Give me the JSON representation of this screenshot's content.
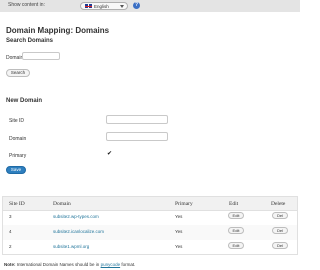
{
  "topbar": {
    "show_content_label": "Show content in:",
    "language_selected": "English",
    "flag_icon": "uk-flag-icon",
    "help_icon": "help-icon",
    "help_symbol": "?"
  },
  "page": {
    "title": "Domain Mapping: Domains"
  },
  "search": {
    "heading": "Search Domains",
    "domain_label": "Domain :",
    "domain_value": "",
    "button_label": "Search"
  },
  "new_domain": {
    "heading": "New Domain",
    "site_id_label": "Site ID",
    "domain_label": "Domain",
    "primary_label": "Primary",
    "primary_checked": true,
    "checkmark": "✔",
    "save_label": "Save"
  },
  "table": {
    "columns": [
      "Site ID",
      "Domain",
      "Primary",
      "Edit",
      "Delete"
    ],
    "rows": [
      {
        "site_id": "3",
        "domain": "subsite2.wp-types.com",
        "primary": "Yes",
        "edit": "Edit",
        "delete": "Del"
      },
      {
        "site_id": "4",
        "domain": "subsite2.icanlocalize.com",
        "primary": "Yes",
        "edit": "Edit",
        "delete": "Del"
      },
      {
        "site_id": "2",
        "domain": "subsite1.wpml.org",
        "primary": "Yes",
        "edit": "Edit",
        "delete": "Del"
      }
    ]
  },
  "footer": {
    "note_label": "Note:",
    "note_text": "International Domain Names should be in",
    "note_link": "punycode",
    "note_suffix": "format."
  },
  "colors": {
    "link": "#21759b",
    "primary_button": "#2e7fbf",
    "topbar": "#e4e4e4"
  }
}
